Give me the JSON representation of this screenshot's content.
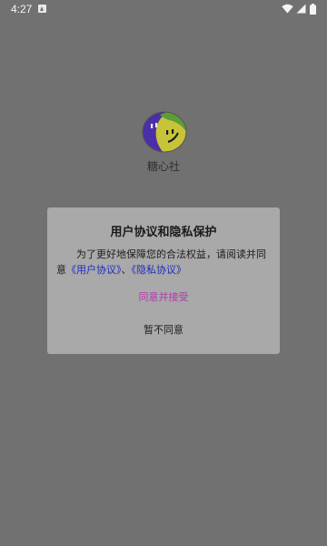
{
  "status_bar": {
    "time": "4:27",
    "icons": [
      "notification-icon",
      "wifi-icon",
      "cell-signal-icon",
      "battery-icon"
    ]
  },
  "app": {
    "name": "糖心社",
    "logo_icon": "smiley-face-logo",
    "logo_colors": {
      "purple": "#4b2fa8",
      "green": "#5a9e35",
      "yellow": "#c7c43a"
    }
  },
  "dialog": {
    "title": "用户协议和隐私保护",
    "body_prefix": "为了更好地保障您的合法权益，请阅读并同意",
    "user_agreement_link": "《用户协议》",
    "separator": "、",
    "privacy_policy_link": "《隐私协议》",
    "accept_label": "同意并接受",
    "decline_label": "暂不同意"
  },
  "colors": {
    "overlay_background": "#717171",
    "dialog_background": "#a9a9a9",
    "link": "#1f2ac0",
    "accept": "#b437b1"
  }
}
